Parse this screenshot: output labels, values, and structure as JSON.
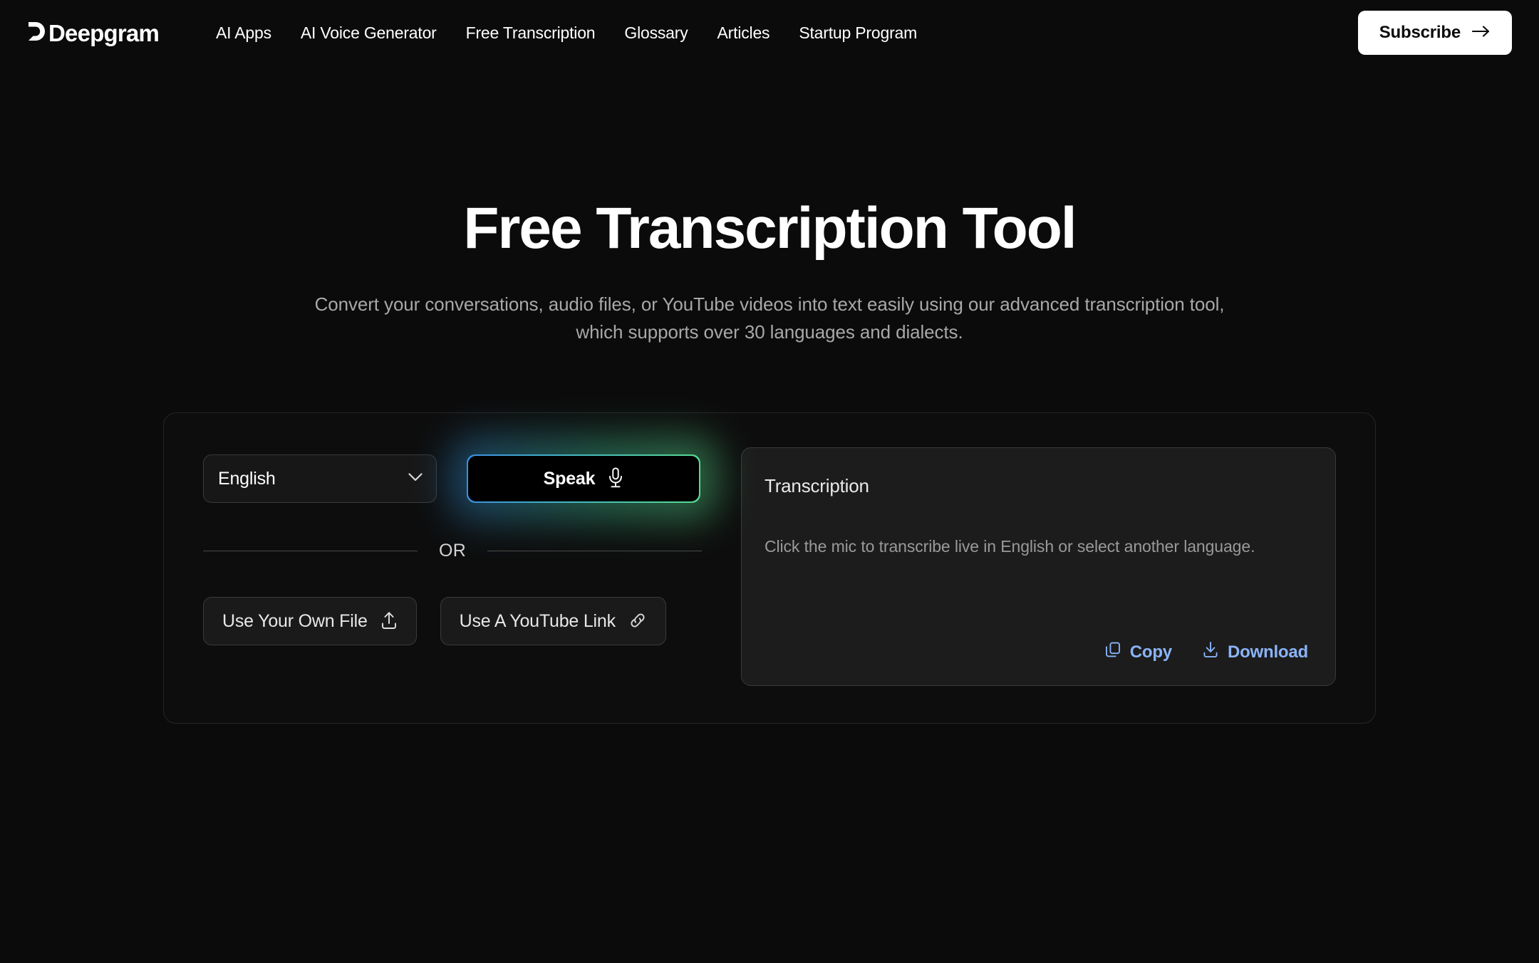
{
  "header": {
    "logo_text": "Deepgram",
    "logo_icon": "deepgram-d-mark",
    "nav": [
      {
        "label": "AI Apps"
      },
      {
        "label": "AI Voice Generator"
      },
      {
        "label": "Free Transcription"
      },
      {
        "label": "Glossary"
      },
      {
        "label": "Articles"
      },
      {
        "label": "Startup Program"
      }
    ],
    "subscribe_label": "Subscribe",
    "subscribe_icon": "arrow-right-icon"
  },
  "hero": {
    "title": "Free Transcription Tool",
    "subtitle": "Convert your conversations, audio files, or YouTube videos into text easily using our advanced transcription tool, which supports over 30 languages and dialects."
  },
  "tool": {
    "language": {
      "selected": "English",
      "options": [
        "English"
      ],
      "chevron_icon": "chevron-down-icon"
    },
    "speak": {
      "label": "Speak",
      "icon": "microphone-icon"
    },
    "divider_label": "OR",
    "file_button": {
      "label": "Use Your Own File",
      "icon": "upload-icon"
    },
    "youtube_button": {
      "label": "Use A YouTube Link",
      "icon": "link-icon"
    }
  },
  "transcription": {
    "title": "Transcription",
    "placeholder": "Click the mic to transcribe live in English or select another language.",
    "copy_label": "Copy",
    "copy_icon": "copy-icon",
    "download_label": "Download",
    "download_icon": "download-icon"
  },
  "colors": {
    "page_background": "#0B0B0B",
    "accent_blue": "#8AB4F8",
    "gradient_start": "#3B8FE0",
    "gradient_end": "#56DB8E",
    "button_white": "#FFFFFF"
  }
}
